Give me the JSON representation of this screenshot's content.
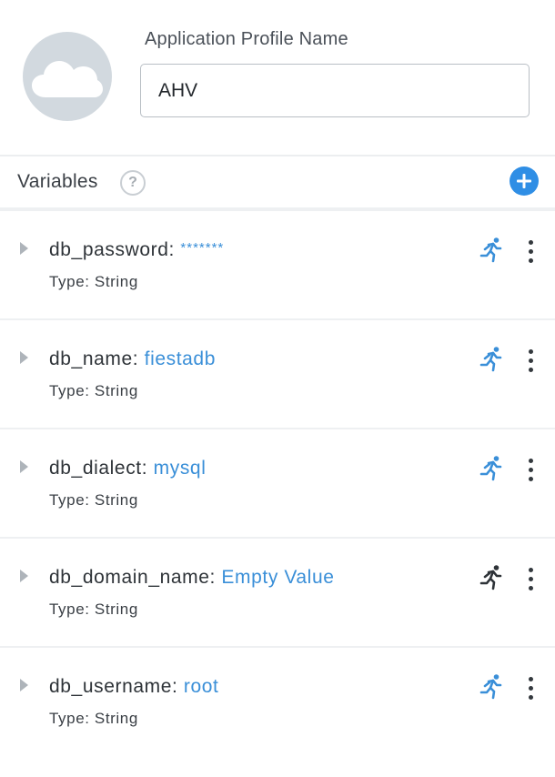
{
  "profile": {
    "avatar_icon": "cloud-icon",
    "field_label": "Application Profile Name",
    "name_value": "AHV"
  },
  "variables": {
    "title": "Variables",
    "help_glyph": "?",
    "add_icon": "plus-icon",
    "items": [
      {
        "name": "db_password:",
        "value": "*******",
        "masked": true,
        "type": "Type: String",
        "runtime_editable": true,
        "runtime_color": "#3a8fd8"
      },
      {
        "name": "db_name:",
        "value": "fiestadb",
        "masked": false,
        "type": "Type: String",
        "runtime_editable": true,
        "runtime_color": "#3a8fd8"
      },
      {
        "name": "db_dialect:",
        "value": "mysql",
        "masked": false,
        "type": "Type: String",
        "runtime_editable": true,
        "runtime_color": "#3a8fd8"
      },
      {
        "name": "db_domain_name:",
        "value": "Empty Value",
        "masked": false,
        "type": "Type: String",
        "runtime_editable": false,
        "runtime_color": "#2e3338"
      },
      {
        "name": "db_username:",
        "value": "root",
        "masked": false,
        "type": "Type: String",
        "runtime_editable": true,
        "runtime_color": "#3a8fd8"
      }
    ]
  },
  "colors": {
    "accent": "#2f8ee5",
    "value_text": "#3a8fd8",
    "avatar_bg": "#d2d9df"
  }
}
